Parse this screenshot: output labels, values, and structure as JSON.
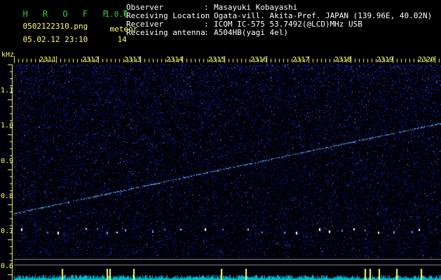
{
  "app": {
    "brand": "H R O F F T",
    "version": "1.0.0"
  },
  "file": {
    "name": "0502122310.png",
    "timestamp": "05.02.12 23:10"
  },
  "meteor": {
    "label": "meteor",
    "count": "14"
  },
  "station": {
    "rows": [
      {
        "key": "Observer",
        "value": "Masayuki Kobayashi"
      },
      {
        "key": "Receiving Location",
        "value": "Ogata-vill. Akita-Pref. JAPAN (139.96E, 40.02N)"
      },
      {
        "key": "Receiver",
        "value": "ICOM IC-575 53.7492(@LCD)MHz USB"
      },
      {
        "key": "Receiving antenna",
        "value": "A504HB(yagi 4el)"
      }
    ],
    "separator": ":"
  },
  "spectrogram": {
    "unit": "kHz",
    "time_ticks": [
      "2311",
      "2312",
      "2313",
      "2314",
      "2315",
      "2316",
      "2317",
      "2318",
      "2319",
      "2320"
    ],
    "freq_ticks": [
      "1.1",
      "1.0",
      "0.9",
      "0.8",
      "0.7",
      "0.6"
    ],
    "colors": {
      "background": "#000010",
      "noise": "#2233ff",
      "signal": "#ffff66",
      "trace": "#44aaff"
    }
  }
}
